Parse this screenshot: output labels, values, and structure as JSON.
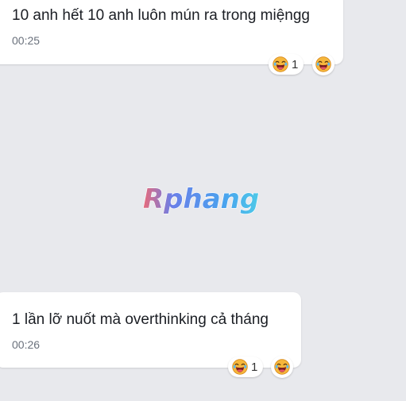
{
  "messages": [
    {
      "text": "10 anh hết 10 anh luôn mún ra trong miệngg",
      "time": "00:25",
      "reaction": {
        "icon": "laughing-face-icon",
        "count": "1"
      }
    },
    {
      "text": "1 lần lỡ nuốt mà overthinking cả tháng",
      "time": "00:26",
      "reaction": {
        "icon": "laughing-face-icon",
        "count": "1"
      }
    }
  ],
  "watermark": {
    "text": "Rphang"
  },
  "colors": {
    "background": "#e8e9ed",
    "bubble": "#ffffff",
    "text": "#1b1e24",
    "time": "#6a717c"
  }
}
